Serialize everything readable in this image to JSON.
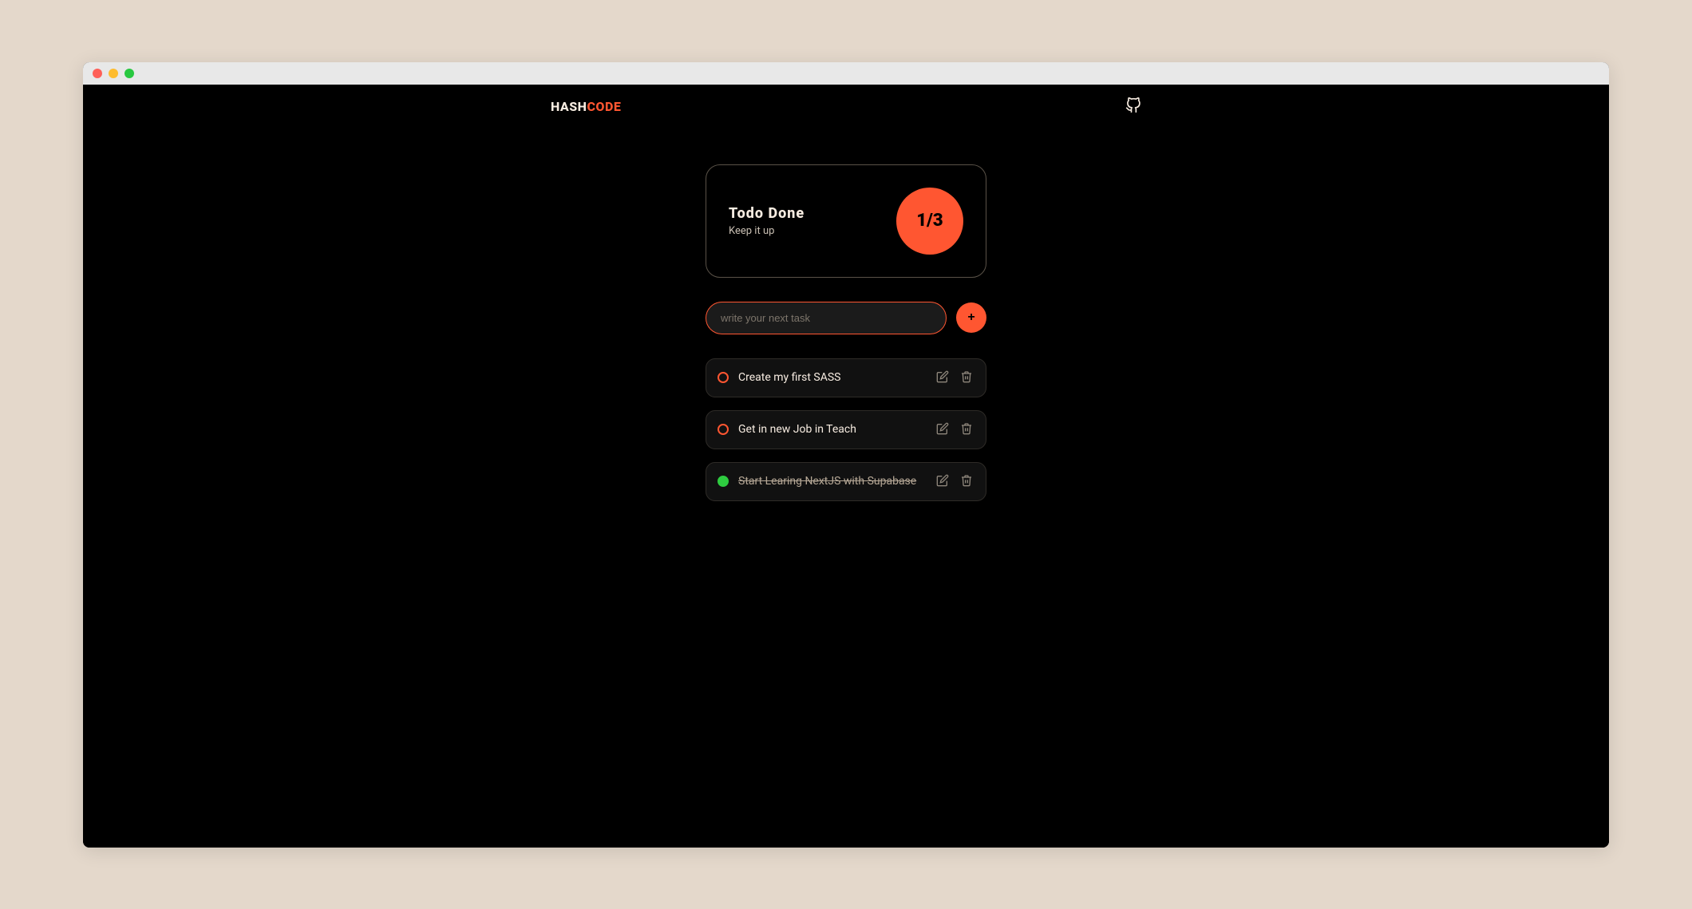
{
  "logo": {
    "first": "HASH",
    "second": "CODE"
  },
  "stat": {
    "title": "Todo Done",
    "subtitle": "Keep it up",
    "counter": "1/3"
  },
  "input": {
    "placeholder": "write your next task",
    "value": ""
  },
  "tasks": [
    {
      "text": "Create my first SASS",
      "done": false
    },
    {
      "text": "Get in new Job in Teach",
      "done": false
    },
    {
      "text": "Start Learing NextJS with Supabase",
      "done": true
    }
  ],
  "colors": {
    "accent": "#ff5631",
    "background": "#000000",
    "text": "#f7ece1",
    "done": "#2ecc40"
  }
}
